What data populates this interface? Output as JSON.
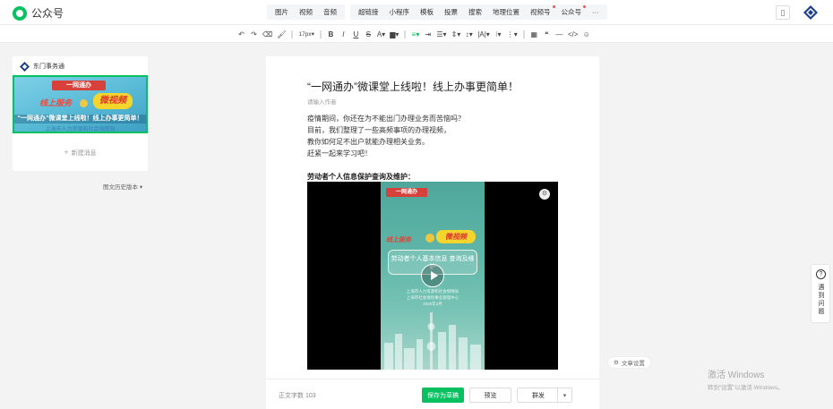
{
  "app": {
    "name": "公众号"
  },
  "menu": {
    "group1": [
      "图片",
      "视频",
      "音频"
    ],
    "group2": [
      "超链接",
      "小程序",
      "模板",
      "投票",
      "搜索",
      "地理位置",
      "视频号",
      "公众号",
      "···"
    ]
  },
  "toolbar": {
    "font_size": "17px",
    "strike": "S",
    "bold": "B",
    "italic": "I",
    "underline": "U"
  },
  "sidebar": {
    "account": "东门事务通",
    "cover": {
      "logo": "一网通办",
      "left": "线上服务",
      "right": "微视频",
      "title": "“一网通办”微课堂上线啦！线上办事更简单！",
      "subtitle": "上海市人力资源和社会保障局"
    },
    "new_message": "新建消息",
    "history": "图文历史版本"
  },
  "article": {
    "title": "“一网通办”微课堂上线啦！线上办事更简单！",
    "author_placeholder": "请输入作者",
    "paragraphs": [
      "疫情期间，你还在为不能出门办理业务而苦恼吗？",
      "目前，我们整理了一些高频事项的办理视频，",
      "教你如何足不出户就能办理相关业务。",
      "赶紧一起来学习吧！"
    ],
    "subheading": "劳动者个人信息保护查询及维护：",
    "video": {
      "logo": "一网通办",
      "left": "线上服务",
      "right": "微视频",
      "box_text": "劳动者个人基本信息 查询及维护",
      "small_lines": [
        "上海市人力资源和社会保障局",
        "上海市社会保险事业管理中心",
        "2020年2月"
      ]
    }
  },
  "bottom": {
    "word_count_label": "正文字数",
    "word_count": "103",
    "save": "保存为草稿",
    "preview": "预览",
    "publish": "群发"
  },
  "right": {
    "article_settings": "文章设置",
    "help": [
      "遇",
      "到",
      "问",
      "题"
    ]
  },
  "watermark": {
    "title": "激活 Windows",
    "subtitle": "转到“设置”以激活 Windows。"
  },
  "colors": {
    "accent": "#07c160",
    "danger": "#fa5151"
  }
}
